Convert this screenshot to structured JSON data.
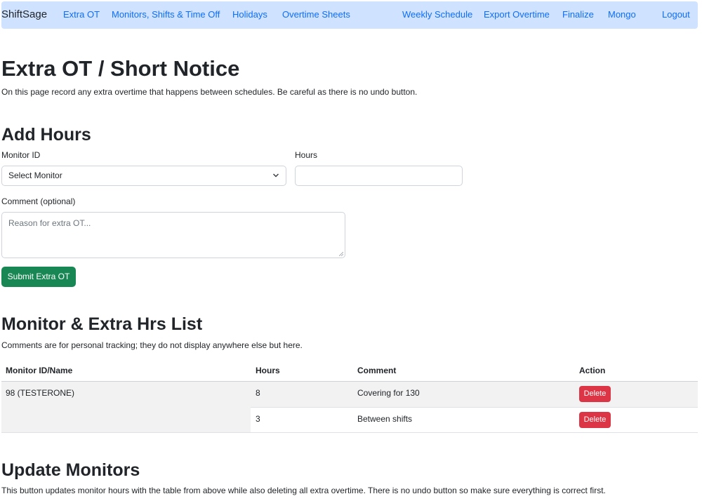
{
  "navbar": {
    "brand": "ShiftSage",
    "links": [
      "Extra OT",
      "Monitors, Shifts & Time Off",
      "Holidays",
      "Overtime Sheets",
      "Weekly Schedule",
      "Export Overtime",
      "Finalize",
      "Mongo",
      "Logout"
    ]
  },
  "page": {
    "title": "Extra OT / Short Notice",
    "intro": "On this page record any extra overtime that happens between schedules. Be careful as there is no undo button."
  },
  "add_hours": {
    "heading": "Add Hours",
    "monitor_label": "Monitor ID",
    "monitor_selected": "Select Monitor",
    "hours_label": "Hours",
    "hours_value": "",
    "comment_label": "Comment (optional)",
    "comment_placeholder": "Reason for extra OT...",
    "submit_label": "Submit Extra OT"
  },
  "list": {
    "heading": "Monitor & Extra Hrs List",
    "note": "Comments are for personal tracking; they do not display anywhere else but here.",
    "columns": [
      "Monitor ID/Name",
      "Hours",
      "Comment",
      "Action"
    ],
    "group_name": "98 (TESTERONE)",
    "rows": [
      {
        "hours": "8",
        "comment": "Covering for 130",
        "action": "Delete"
      },
      {
        "hours": "3",
        "comment": "Between shifts",
        "action": "Delete"
      }
    ]
  },
  "update": {
    "heading": "Update Monitors",
    "text": "This button updates monitor hours with the table from above while also deleting all extra overtime. There is no undo button so make sure everything is correct first."
  },
  "colors": {
    "navbar_bg": "#cfe2ff",
    "link": "#0d6efd",
    "success": "#198754",
    "danger": "#dc3545",
    "striped_row": "#f2f2f2"
  }
}
